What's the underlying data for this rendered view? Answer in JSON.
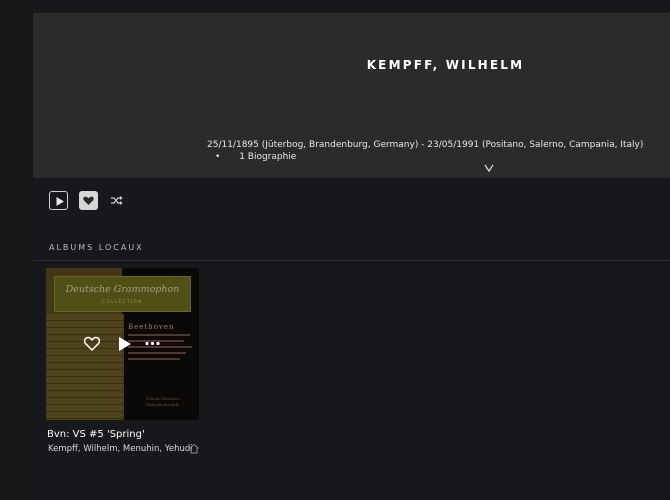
{
  "artist": {
    "name": "KEMPFF, WILHELM",
    "dates": "25/11/1895 (Jüterbog, Brandenburg, Germany) - 23/05/1991 (Positano, Salerno, Campania, Italy)",
    "bio_bullet": "•",
    "bio_label": "1 Biographie"
  },
  "actions": {
    "play_icon": "play-icon",
    "favorite_icon": "heart-icon",
    "shuffle_icon": "shuffle-icon"
  },
  "section": {
    "title": "ALBUMS LOCAUX"
  },
  "albums": [
    {
      "title": "Bvn: VS #5 'Spring'",
      "artists": "Kempff, Wilhelm, Menuhin, Yehudi",
      "cover": {
        "brand": "Deutsche Grammophon",
        "sub": "COLLECTION",
        "composer": "Beethoven",
        "performers_line1": "Yehudi Menuhin",
        "performers_line2": "Wilhelm Kempff"
      }
    }
  ],
  "colors": {
    "background": "#16181b",
    "hero": "#2b2b2b",
    "text": "#ffffff"
  }
}
